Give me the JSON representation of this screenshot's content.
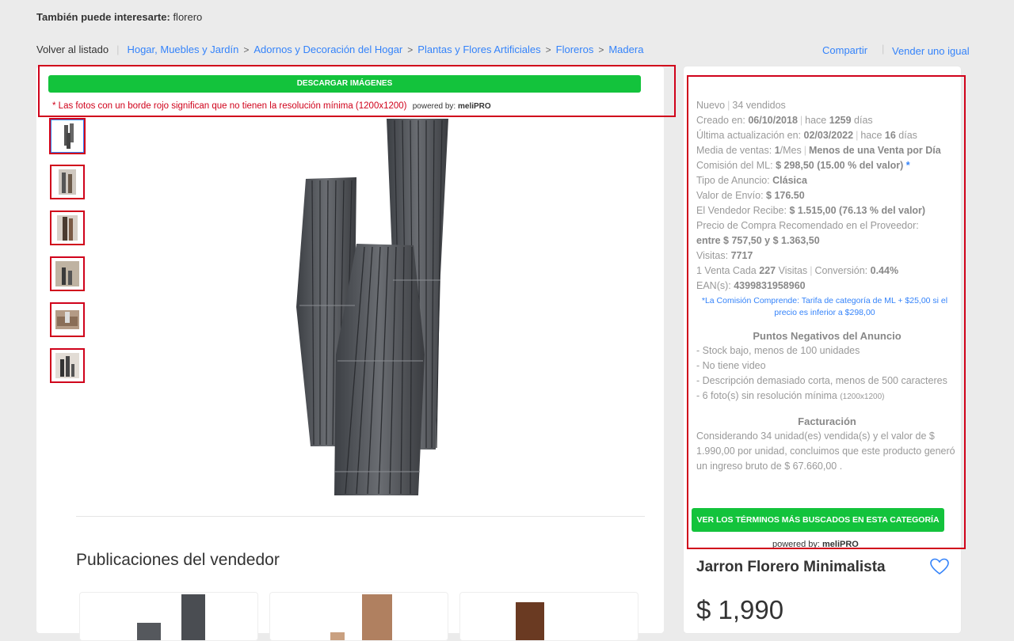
{
  "suggest": {
    "label": "También puede interesarte:",
    "value": "florero"
  },
  "breadcrumb": {
    "back": "Volver al listado",
    "items": [
      "Hogar, Muebles y Jardín",
      "Adornos y Decoración del Hogar",
      "Plantas y Flores Artificiales",
      "Floreros",
      "Madera"
    ]
  },
  "actions": {
    "share": "Compartir",
    "sell": "Vender uno igual"
  },
  "melipro": {
    "download_btn": "DESCARGAR IMÁGENES",
    "note": "* Las fotos con un borde rojo significan que no tienen la resolución mínima (1200x1200)",
    "powered_prefix": "powered by:",
    "powered_brand": "meliPRO"
  },
  "thumbnails": [
    "thumb-1",
    "thumb-2",
    "thumb-3",
    "thumb-4",
    "thumb-5",
    "thumb-6"
  ],
  "info": {
    "condition": "Nuevo",
    "sold": "34 vendidos",
    "created_label": "Creado en:",
    "created_date": "06/10/2018",
    "created_ago_prefix": "hace",
    "created_ago_days": "1259",
    "created_ago_suffix": "días",
    "updated_label": "Última actualización en:",
    "updated_date": "02/03/2022",
    "updated_ago_prefix": "hace",
    "updated_ago_days": "16",
    "updated_ago_suffix": "días",
    "avg_label": "Media de ventas:",
    "avg_value": "1",
    "avg_unit": "/Mes",
    "avg_note": "Menos de una Venta por Día",
    "commission_label": "Comisión del ML:",
    "commission_value": "$ 298,50 (15.00 % del valor)",
    "commission_star": "*",
    "ad_type_label": "Tipo de Anuncio:",
    "ad_type_value": "Clásica",
    "shipping_label": "Valor de Envío:",
    "shipping_value": "$ 176.50",
    "seller_gets_label": "El Vendedor Recibe:",
    "seller_gets_value": "$ 1.515,00 (76.13 % del valor)",
    "buy_price_label": "Precio de Compra Recomendado en el Proveedor:",
    "buy_price_value": "entre $ 757,50 y $ 1.363,50",
    "visits_label": "Visitas:",
    "visits_value": "7717",
    "conv_prefix": "1 Venta Cada",
    "conv_visits": "227",
    "conv_suffix": "Visitas",
    "conv_label": "Conversión:",
    "conv_value": "0.44%",
    "ean_label": "EAN(s):",
    "ean_value": "4399831958960",
    "commission_note": "*La Comisión Comprende: Tarifa de categoría de ML + $25,00 si el precio es inferior a $298,00"
  },
  "negatives": {
    "title": "Puntos Negativos del Anuncio",
    "items": [
      "- Stock bajo, menos de 100 unidades",
      "- No tiene video",
      "- Descripción demasiado corta, menos de 500 caracteres"
    ],
    "photos_item": "- 6 foto(s) sin resolución mínima",
    "photos_small": "(1200x1200)"
  },
  "billing": {
    "title": "Facturación",
    "text": "Considerando 34 unidad(es) vendida(s) y el valor de $ 1.990,00 por unidad, concluimos que este producto generó un ingreso bruto de $ 67.660,00 ."
  },
  "terms_btn": "VER LOS TÉRMINOS MÁS BUSCADOS EN ESTA CATEGORÍA",
  "powered2": {
    "prefix": "powered by:",
    "brand": "meliPRO"
  },
  "product": {
    "title": "Jarron Florero Minimalista",
    "price": "$ 1,990"
  },
  "seller_pubs": {
    "title": "Publicaciones del vendedor"
  },
  "colors": {
    "accent_blue": "#3483fa",
    "green": "#13c33c",
    "red_border": "#d0021b"
  }
}
